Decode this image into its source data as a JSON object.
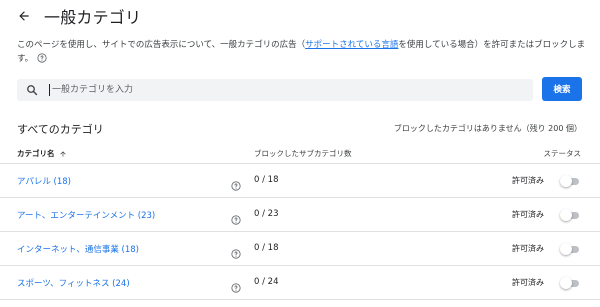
{
  "header": {
    "title": "一般カテゴリ"
  },
  "description": {
    "text_before": "このページを使用し、サイトでの広告表示について、一般カテゴリの広告（",
    "link_text": "サポートされている言語",
    "text_after": "を使用している場合）を許可またはブロックします。"
  },
  "search": {
    "placeholder": "一般カテゴリを入力",
    "button_label": "検索"
  },
  "section": {
    "title": "すべてのカテゴリ",
    "blocked_info": "ブロックしたカテゴリはありません（残り 200 個）"
  },
  "table": {
    "columns": {
      "name": "カテゴリ名",
      "subcategories": "ブロックしたサブカテゴリ数",
      "status": "ステータス"
    },
    "rows": [
      {
        "name": "アパレル (18)",
        "count": "0 / 18",
        "status": "許可済み"
      },
      {
        "name": "アート、エンターテインメント (23)",
        "count": "0 / 23",
        "status": "許可済み"
      },
      {
        "name": "インターネット、通信事業 (18)",
        "count": "0 / 18",
        "status": "許可済み"
      },
      {
        "name": "スポーツ、フィットネス (24)",
        "count": "0 / 24",
        "status": "許可済み"
      }
    ]
  },
  "icons": {
    "back": "arrow-back-icon",
    "help": "help-circle-icon",
    "search": "search-icon",
    "sort": "arrow-up-icon"
  },
  "colors": {
    "accent": "#1a73e8",
    "toggle_off": "#bdc1c6",
    "divider": "#e0e0e0"
  }
}
